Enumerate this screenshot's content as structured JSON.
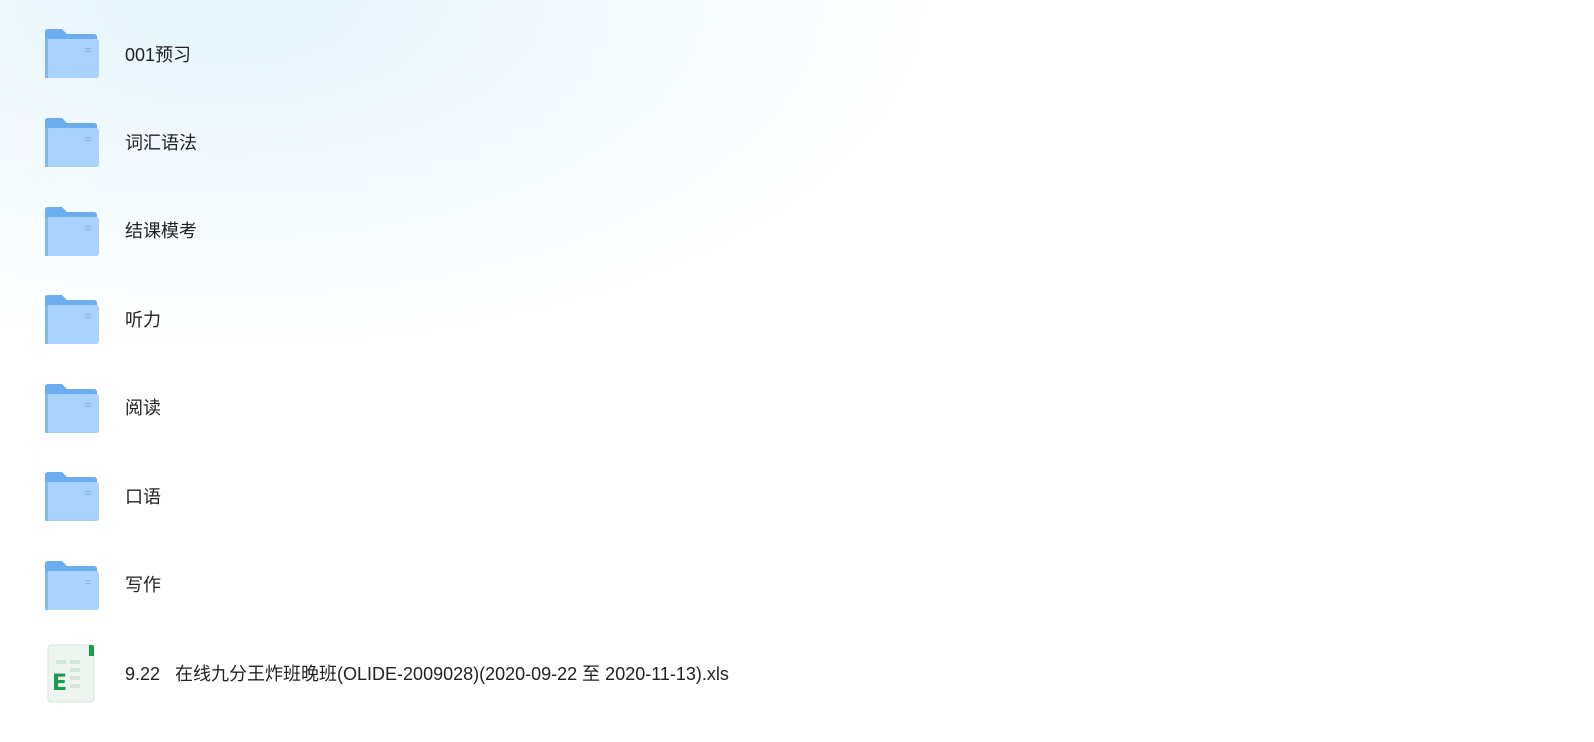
{
  "files": [
    {
      "name": "001预习",
      "type": "folder",
      "icon": "folder-icon"
    },
    {
      "name": "词汇语法",
      "type": "folder",
      "icon": "folder-icon"
    },
    {
      "name": "结课模考",
      "type": "folder",
      "icon": "folder-icon"
    },
    {
      "name": "听力",
      "type": "folder",
      "icon": "folder-icon"
    },
    {
      "name": "阅读",
      "type": "folder",
      "icon": "folder-icon"
    },
    {
      "name": "口语",
      "type": "folder",
      "icon": "folder-icon"
    },
    {
      "name": "写作",
      "type": "folder",
      "icon": "folder-icon"
    },
    {
      "name": "9.22   在线九分王炸班晚班(OLIDE-2009028)(2020-09-22 至 2020-11-13).xls",
      "type": "spreadsheet",
      "icon": "excel-file-icon"
    }
  ],
  "colors": {
    "folder_front": "#a9d3fb",
    "folder_back": "#6aaef0",
    "excel_green": "#1e9a4e",
    "text": "#222222"
  }
}
